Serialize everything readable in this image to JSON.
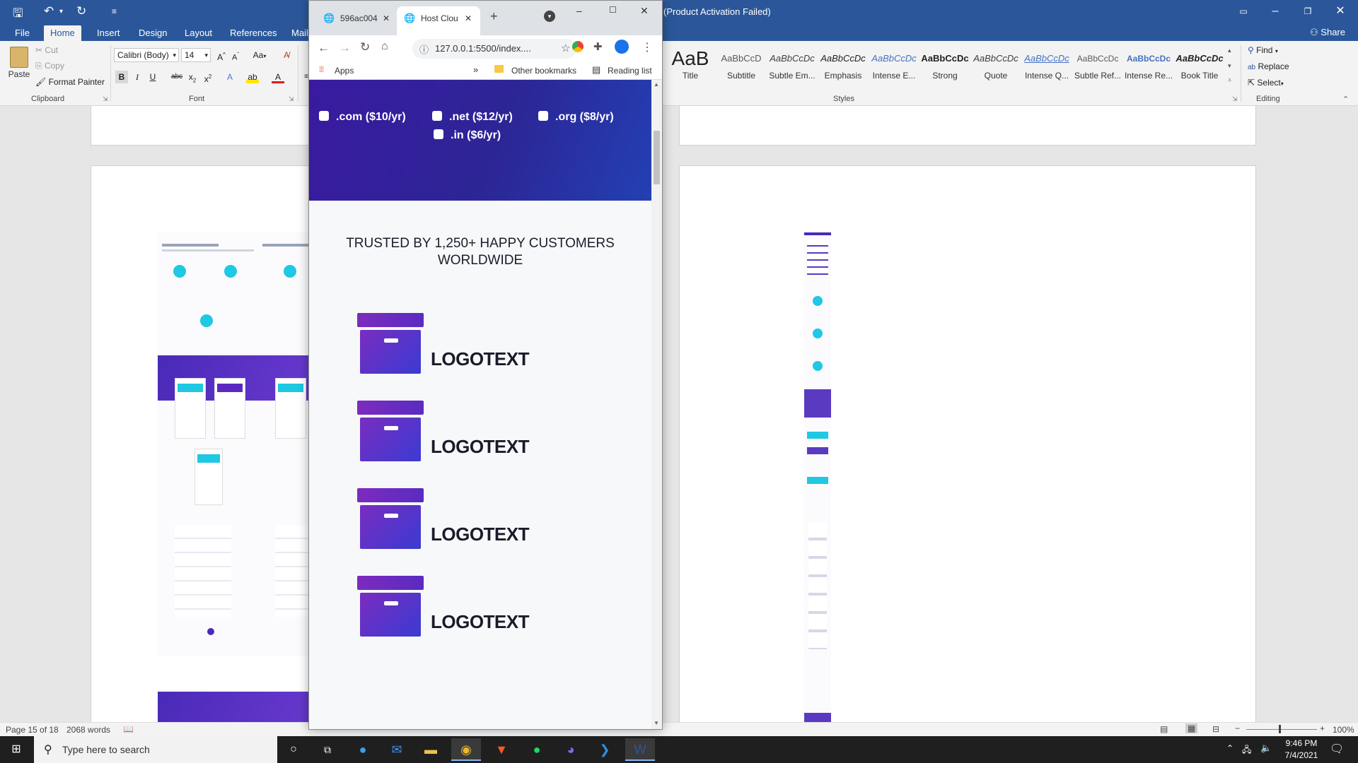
{
  "word": {
    "title": "(Product Activation Failed)",
    "tabs": [
      "File",
      "Home",
      "Insert",
      "Design",
      "Layout",
      "References",
      "Mail"
    ],
    "active_tab": "Home",
    "share_label": "Share",
    "clipboard": {
      "paste": "Paste",
      "cut": "Cut",
      "copy": "Copy",
      "format_painter": "Format Painter",
      "label": "Clipboard"
    },
    "font": {
      "family": "Calibri (Body)",
      "size": "14",
      "label": "Font",
      "case_label": "Aa"
    },
    "styles": {
      "label": "Styles",
      "items": [
        {
          "sample": "AaB",
          "name": "Title"
        },
        {
          "sample": "AaBbCcD",
          "name": "Subtitle"
        },
        {
          "sample": "AaBbCcDc",
          "name": "Subtle Em..."
        },
        {
          "sample": "AaBbCcDc",
          "name": "Emphasis"
        },
        {
          "sample": "AaBbCcDc",
          "name": "Intense E..."
        },
        {
          "sample": "AaBbCcDc",
          "name": "Strong"
        },
        {
          "sample": "AaBbCcDc",
          "name": "Quote"
        },
        {
          "sample": "AaBbCcDc",
          "name": "Intense Q..."
        },
        {
          "sample": "AaBbCcDc",
          "name": "Subtle Ref..."
        },
        {
          "sample": "AaBbCcDc",
          "name": "Intense Re..."
        },
        {
          "sample": "AaBbCcDc",
          "name": "Book Title"
        }
      ]
    },
    "editing": {
      "find": "Find",
      "replace": "Replace",
      "select": "Select",
      "label": "Editing"
    },
    "status": {
      "page": "Page 15 of 18",
      "words": "2068 words",
      "zoom": "100%"
    }
  },
  "chrome": {
    "tabs": [
      {
        "title": "596ac004"
      },
      {
        "title": "Host Clou"
      }
    ],
    "url": "127.0.0.1:5500/index....",
    "bookmarks": {
      "apps": "Apps",
      "other": "Other bookmarks",
      "reading": "Reading list",
      "more": "»"
    },
    "page": {
      "domains": [
        ".com ($10/yr)",
        ".net ($12/yr)",
        ".org ($8/yr)",
        ".in ($6/yr)"
      ],
      "trusted_heading": "TRUSTED BY 1,250+ HAPPY CUSTOMERS WORLDWIDE",
      "logos": [
        "LOGOTEXT",
        "LOGOTEXT",
        "LOGOTEXT",
        "LOGOTEXT"
      ]
    }
  },
  "taskbar": {
    "search_placeholder": "Type here to search",
    "time": "9:46 PM",
    "date": "7/4/2021"
  },
  "colors": {
    "word_blue": "#2b579a",
    "hero_purple": "#3a1aa0",
    "logo_gradient_start": "#7a2cc0",
    "logo_gradient_end": "#3a3bd2"
  }
}
